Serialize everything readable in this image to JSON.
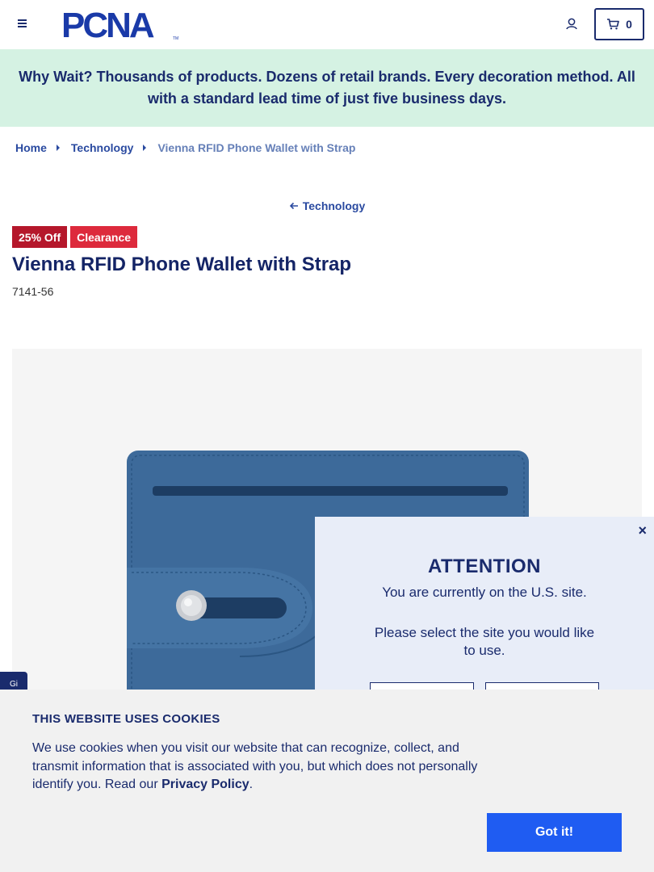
{
  "header": {
    "logo_text": "PCNA",
    "logo_tm": "TM",
    "cart_count": "0"
  },
  "promo": {
    "text": "Why Wait? Thousands of products. Dozens of retail brands. Every decoration method. All with a standard lead time of just five business days."
  },
  "breadcrumb": {
    "home": "Home",
    "category": "Technology",
    "current": "Vienna RFID Phone Wallet with Strap"
  },
  "back_link": {
    "label": "Technology"
  },
  "badges": {
    "discount": "25% Off",
    "clearance": "Clearance"
  },
  "product": {
    "title": "Vienna RFID Phone Wallet with Strap",
    "sku": "7141-56",
    "color_hex": "#3d6a9a"
  },
  "side_tab": {
    "label": "Gi"
  },
  "modal": {
    "close": "×",
    "title": "ATTENTION",
    "line1": "You are currently on the U.S. site.",
    "line2": "Please select the site you would like to use."
  },
  "cookie": {
    "title": "THIS WEBSITE USES COOKIES",
    "text": "We use cookies when you visit our website that can recognize, collect, and transmit information that is associated with you, but which does not personally identify you. Read our ",
    "policy_link": "Privacy Policy",
    "text_end": ".",
    "button": "Got it!"
  }
}
